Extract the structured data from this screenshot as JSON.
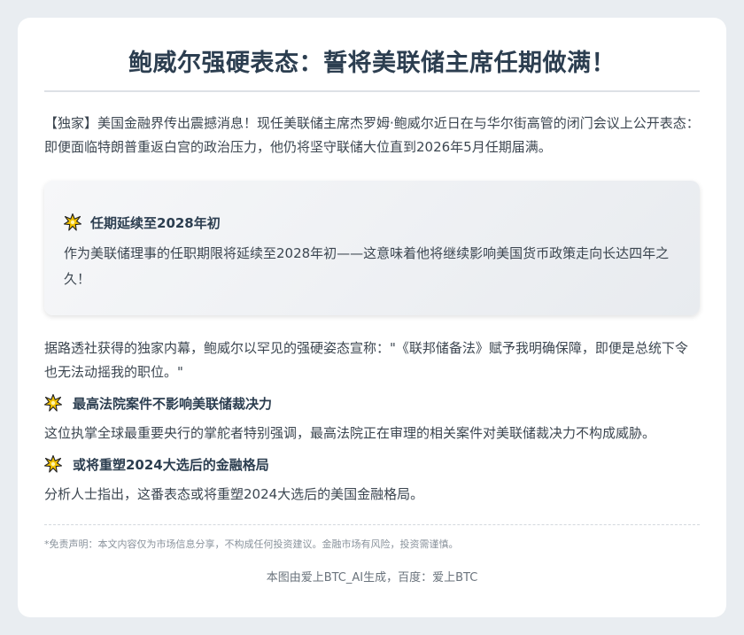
{
  "article": {
    "title": "鲍威尔强硬表态：誓将美联储主席任期做满！",
    "lead": "【独家】美国金融界传出震撼消息！现任美联储主席杰罗姆·鲍威尔近日在与华尔街高管的闭门会议上公开表态：即便面临特朗普重返白宫的政治压力，他仍将坚守联储大位直到2026年5月任期届满。",
    "highlight": {
      "icon": "burst-icon",
      "title": "任期延续至2028年初",
      "body": "作为美联储理事的任职期限将延续至2028年初——这意味着他将继续影响美国货币政策走向长达四年之久！"
    },
    "quote_paragraph": "据路透社获得的独家内幕，鲍威尔以罕见的强硬姿态宣称：\"《联邦储备法》赋予我明确保障，即便是总统下令也无法动摇我的职位。\"",
    "sections": [
      {
        "icon": "burst-icon",
        "title": "最高法院案件不影响美联储裁决力",
        "body": "这位执掌全球最重要央行的掌舵者特别强调，最高法院正在审理的相关案件对美联储裁决力不构成威胁。"
      },
      {
        "icon": "burst-icon",
        "title": "或将重塑2024大选后的金融格局",
        "body": "分析人士指出，这番表态或将重塑2024大选后的美国金融格局。"
      }
    ],
    "disclaimer": "*免责声明：本文内容仅为市场信息分享，不构成任何投资建议。金融市场有风险，投资需谨慎。",
    "credit": "本图由爱上BTC_AI生成，百度：爱上BTC"
  },
  "colors": {
    "background": "#e9edf1",
    "card": "#ffffff",
    "heading": "#2c3e50",
    "body_text": "#3c4650",
    "burst_fill": "#f2c200",
    "burst_outline": "#222222"
  }
}
